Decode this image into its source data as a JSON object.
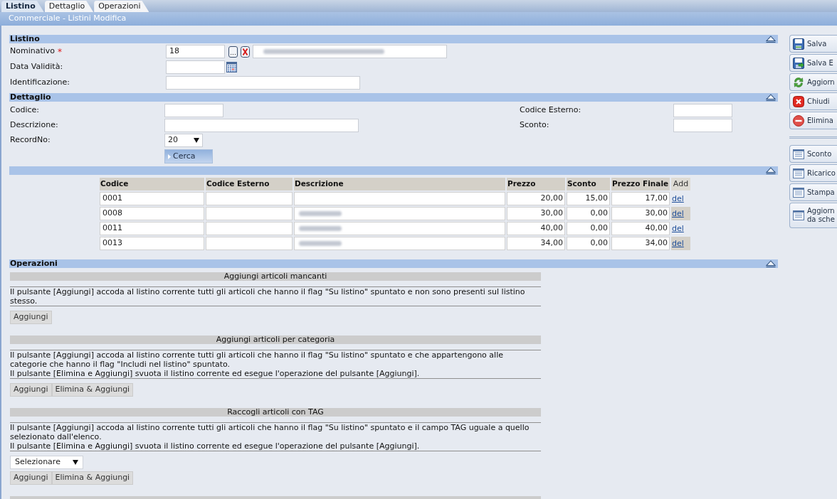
{
  "tabs": [
    {
      "label": "Listino",
      "selected": true
    },
    {
      "label": "Dettaglio",
      "selected": false
    },
    {
      "label": "Operazioni",
      "selected": false
    }
  ],
  "title": "Commerciale - Listini Modifica",
  "listino": {
    "title": "Listino",
    "fields": [
      {
        "kind": "lookup",
        "label": "Nominativo",
        "required_mark": "*",
        "value": "18",
        "lookup_button": "...",
        "name_redacted": true
      },
      {
        "kind": "date",
        "label": "Data Validità:"
      },
      {
        "kind": "text",
        "label": "Identificazione:"
      }
    ]
  },
  "dettaglio": {
    "title": "Dettaglio",
    "rows": [
      [
        {
          "kind": "short",
          "label": "Codice:"
        },
        {
          "kind": "short",
          "label": "Codice Esterno:"
        }
      ],
      [
        {
          "kind": "wide",
          "label": "Descrizione:"
        },
        {
          "kind": "short",
          "label": "Sconto:"
        }
      ],
      [
        {
          "kind": "select",
          "label": "RecordNo:",
          "value": "20"
        }
      ]
    ],
    "search_button": "Cerca"
  },
  "results": {
    "columns": [
      {
        "label": "Codice",
        "kind": "text"
      },
      {
        "label": "Codice Esterno",
        "kind": "text"
      },
      {
        "label": "Descrizione",
        "kind": "text"
      },
      {
        "label": "Prezzo",
        "kind": "number"
      },
      {
        "label": "Sconto",
        "kind": "number"
      },
      {
        "label": "Prezzo Finale",
        "kind": "number"
      },
      {
        "label": "Add",
        "kind": "action"
      }
    ],
    "rows": [
      {
        "codice": "0001",
        "descrizione_redacted": false,
        "prezzo": "20,00",
        "sconto": "15,00",
        "prezzo_finale": "17,00",
        "action": "del"
      },
      {
        "codice": "0008",
        "descrizione_redacted": true,
        "prezzo": "30,00",
        "sconto": "0,00",
        "prezzo_finale": "30,00",
        "action": "del"
      },
      {
        "codice": "0011",
        "descrizione_redacted": true,
        "prezzo": "40,00",
        "sconto": "0,00",
        "prezzo_finale": "40,00",
        "action": "del"
      },
      {
        "codice": "0013",
        "descrizione_redacted": true,
        "prezzo": "34,00",
        "sconto": "0,00",
        "prezzo_finale": "34,00",
        "action": "del"
      }
    ]
  },
  "operazioni": {
    "title": "Operazioni",
    "groups": [
      {
        "title": "Aggiungi articoli mancanti",
        "paragraphs": [
          "Il pulsante [Aggiungi] accoda al listino corrente tutti gli articoli che hanno il flag \"Su listino\" spuntato e non sono presenti sul listino stesso."
        ],
        "buttons": [
          "Aggiungi"
        ]
      },
      {
        "title": "Aggiungi articoli per categoria",
        "paragraphs": [
          "Il pulsante [Aggiungi] accoda al listino corrente tutti gli articoli che hanno il flag \"Su listino\" spuntato e che appartengono alle categorie che hanno il flag \"Includi nel listino\" spuntato.",
          "Il pulsante [Elimina e Aggiungi] svuota il listino corrente ed esegue l'operazione del pulsante [Aggiungi]."
        ],
        "buttons": [
          "Aggiungi",
          "Elimina & Aggiungi"
        ]
      },
      {
        "title": "Raccogli articoli con TAG",
        "paragraphs": [
          "Il pulsante [Aggiungi] accoda al listino corrente tutti gli articoli che hanno il flag \"Su listino\" spuntato e il campo TAG uguale a quello selezionato dall'elenco.",
          "Il pulsante [Elimina e Aggiungi] svuota il listino corrente ed esegue l'operazione del pulsante [Aggiungi]."
        ],
        "select": {
          "value": "Selezionare"
        },
        "buttons": [
          "Aggiungi",
          "Elimina & Aggiungi"
        ]
      }
    ]
  },
  "toolbar": [
    [
      {
        "kind": "save",
        "label": "Salva"
      },
      {
        "kind": "save_export",
        "label": "Salva E"
      },
      {
        "kind": "refresh",
        "label": "Aggiorn"
      },
      {
        "kind": "close",
        "label": "Chiudi"
      },
      {
        "kind": "delete",
        "label": "Elimina"
      }
    ],
    [
      {
        "kind": "list",
        "label": "Sconto"
      },
      {
        "kind": "list",
        "label": "Ricarico"
      },
      {
        "kind": "list",
        "label": "Stampa"
      },
      {
        "kind": "list",
        "label": "Aggiorn\nda sche"
      }
    ]
  ]
}
